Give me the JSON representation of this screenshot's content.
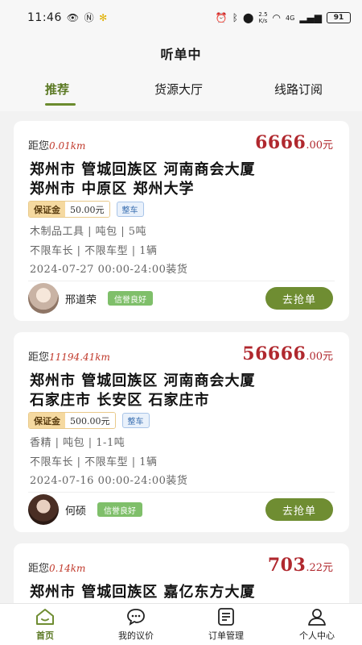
{
  "status": {
    "time": "11:46",
    "net_speed": "2.5\nK/s",
    "signal": "4G",
    "battery": "91"
  },
  "header": {
    "title": "听单中",
    "tabs": [
      {
        "label": "推荐",
        "active": true
      },
      {
        "label": "货源大厅",
        "active": false
      },
      {
        "label": "线路订阅",
        "active": false
      }
    ]
  },
  "orders": [
    {
      "distance_prefix": "距您",
      "distance": "0.01km",
      "price_int": "6666",
      "price_dec": ".00元",
      "from": "郑州市 管城回族区 河南商会大厦",
      "to": "郑州市 中原区 郑州大学",
      "deposit_label": "保证金",
      "deposit_value": "50.00元",
      "load_type": "整车",
      "cargo": "木制品工具 | 吨包 | 5吨",
      "vehicle": "不限车长 | 不限车型 | 1辆",
      "schedule": "2024-07-27 00:00-24:00装货",
      "user_name": "邢道荣",
      "credit": "信誉良好",
      "action": "去抢单"
    },
    {
      "distance_prefix": "距您",
      "distance": "11194.41km",
      "price_int": "56666",
      "price_dec": ".00元",
      "from": "郑州市 管城回族区 河南商会大厦",
      "to": "石家庄市 长安区 石家庄市",
      "deposit_label": "保证金",
      "deposit_value": "500.00元",
      "load_type": "整车",
      "cargo": "香精 | 吨包 | 1-1吨",
      "vehicle": "不限车长 | 不限车型 | 1辆",
      "schedule": "2024-07-16 00:00-24:00装货",
      "user_name": "何硕",
      "credit": "信誉良好",
      "action": "去抢单"
    },
    {
      "distance_prefix": "距您",
      "distance": "0.14km",
      "price_int": "703",
      "price_dec": ".22元",
      "from": "郑州市 管城回族区 嘉亿东方大厦"
    }
  ],
  "tabbar": [
    {
      "label": "首页",
      "icon": "home-icon",
      "active": true
    },
    {
      "label": "我的议价",
      "icon": "chat-bubble-icon",
      "active": false
    },
    {
      "label": "订单管理",
      "icon": "order-list-icon",
      "active": false
    },
    {
      "label": "个人中心",
      "icon": "user-icon",
      "active": false
    }
  ],
  "colors": {
    "accent": "#6f8d32",
    "price": "#b0282e",
    "credit": "#7fbf6a"
  }
}
